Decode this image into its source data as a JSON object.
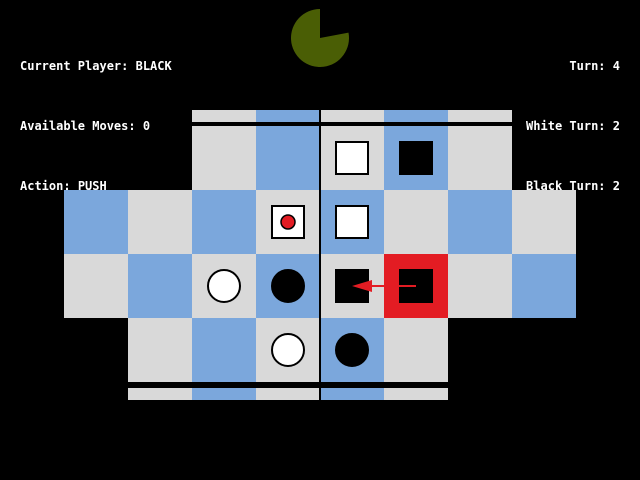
{
  "hud": {
    "current_player_label": "Current Player:",
    "current_player": "BLACK",
    "available_moves_label": "Available Moves:",
    "available_moves": "0",
    "action_label": "Action:",
    "action": "PUSH",
    "turn_label": "Turn:",
    "turn": "4",
    "white_turn_label": "White Turn:",
    "white_turn": "2",
    "black_turn_label": "Black Turn:",
    "black_turn": "2"
  },
  "colors": {
    "background": "#000000",
    "light_tile": "#d9d9d9",
    "blue_tile": "#7ba7dc",
    "white_piece": "#ffffff",
    "black_piece": "#000000",
    "selected": "#e31c23",
    "anchor_dot": "#e31c23",
    "timer": "#4a5e05",
    "arrow": "#e31c23"
  },
  "timer": {
    "remaining_fraction": 0.78
  },
  "board": {
    "rows": [
      {
        "row": 0,
        "cols": [
          2,
          3,
          4,
          5,
          6
        ]
      },
      {
        "row": 1,
        "cols": [
          0,
          1,
          2,
          3,
          4,
          5,
          6,
          7
        ]
      },
      {
        "row": 2,
        "cols": [
          0,
          1,
          2,
          3,
          4,
          5,
          6,
          7
        ]
      },
      {
        "row": 3,
        "cols": [
          1,
          2,
          3,
          4,
          5
        ]
      }
    ],
    "top_rail_cols": [
      2,
      3,
      4,
      5,
      6
    ],
    "bottom_rail_cols": [
      1,
      2,
      3,
      4,
      5
    ],
    "pieces": [
      {
        "row": 0,
        "col": 4,
        "color": "white",
        "shape": "square"
      },
      {
        "row": 0,
        "col": 5,
        "color": "black",
        "shape": "square"
      },
      {
        "row": 1,
        "col": 3,
        "color": "white",
        "shape": "square",
        "anchor": true
      },
      {
        "row": 1,
        "col": 4,
        "color": "white",
        "shape": "square"
      },
      {
        "row": 2,
        "col": 2,
        "color": "white",
        "shape": "circle"
      },
      {
        "row": 2,
        "col": 3,
        "color": "black",
        "shape": "circle"
      },
      {
        "row": 2,
        "col": 4,
        "color": "black",
        "shape": "square"
      },
      {
        "row": 2,
        "col": 5,
        "color": "black",
        "shape": "square",
        "selected": true
      },
      {
        "row": 3,
        "col": 3,
        "color": "white",
        "shape": "circle"
      },
      {
        "row": 3,
        "col": 4,
        "color": "black",
        "shape": "circle"
      }
    ],
    "push_arrow": {
      "from": {
        "row": 2,
        "col": 5
      },
      "to": {
        "row": 2,
        "col": 4
      }
    }
  }
}
